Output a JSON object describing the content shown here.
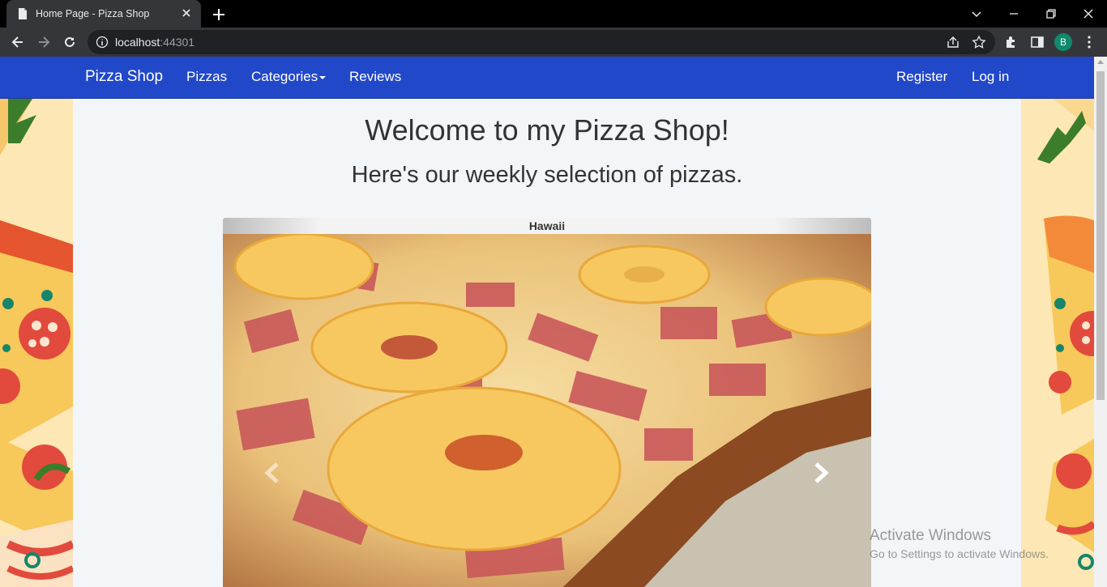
{
  "browser": {
    "tab_title": "Home Page - Pizza Shop",
    "url_host": "localhost",
    "url_port": ":44301",
    "profile_initial": "B"
  },
  "navbar": {
    "brand": "Pizza Shop",
    "links": [
      "Pizzas",
      "Categories",
      "Reviews"
    ],
    "right_links": [
      "Register",
      "Log in"
    ]
  },
  "main": {
    "heading": "Welcome to my Pizza Shop!",
    "subheading": "Here's our weekly selection of pizzas.",
    "carousel": {
      "caption": "Hawaii"
    }
  },
  "watermark": {
    "line1": "Activate Windows",
    "line2": "Go to Settings to activate Windows."
  },
  "colors": {
    "navbar": "#2148c8",
    "page_bg": "#f3f6f9",
    "avatar": "#0f8a6c"
  }
}
